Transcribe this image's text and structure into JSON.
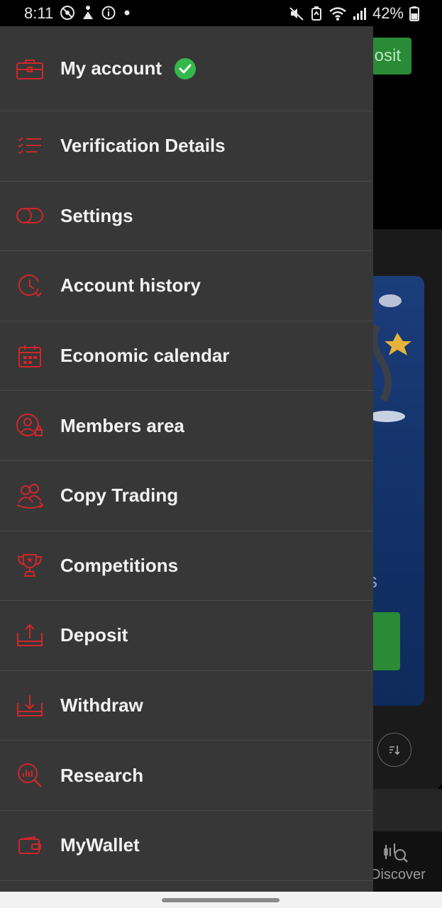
{
  "status_bar": {
    "time": "8:11",
    "battery": "42%",
    "left_icons": [
      "no-disturb-icon",
      "accessibility-icon",
      "info-icon",
      "dot-icon"
    ],
    "right_icons": [
      "mute-icon",
      "battery-saver-icon",
      "wifi-icon",
      "signal-icon",
      "battery-icon"
    ]
  },
  "background_app": {
    "deposit_button_partial": "osit",
    "promo_partial_text": "s",
    "bottom_nav_discover": "Discover",
    "colors": {
      "green": "#2a8a36",
      "blue": "#1b3d7a"
    }
  },
  "drawer": {
    "account": {
      "label": "My account",
      "verified": true
    },
    "items": [
      {
        "label": "Verification Details",
        "icon": "checklist-icon"
      },
      {
        "label": "Settings",
        "icon": "toggle-icon"
      },
      {
        "label": "Account history",
        "icon": "history-clock-icon"
      },
      {
        "label": "Economic calendar",
        "icon": "calendar-icon"
      },
      {
        "label": "Members area",
        "icon": "member-lock-icon"
      },
      {
        "label": "Copy Trading",
        "icon": "copy-trading-users-icon"
      },
      {
        "label": "Competitions",
        "icon": "trophy-icon"
      },
      {
        "label": "Deposit",
        "icon": "deposit-tray-icon"
      },
      {
        "label": "Withdraw",
        "icon": "withdraw-tray-icon"
      },
      {
        "label": "Research",
        "icon": "research-magnifier-icon"
      },
      {
        "label": "MyWallet",
        "icon": "wallet-icon"
      }
    ],
    "accent_color": "#d0262b"
  }
}
